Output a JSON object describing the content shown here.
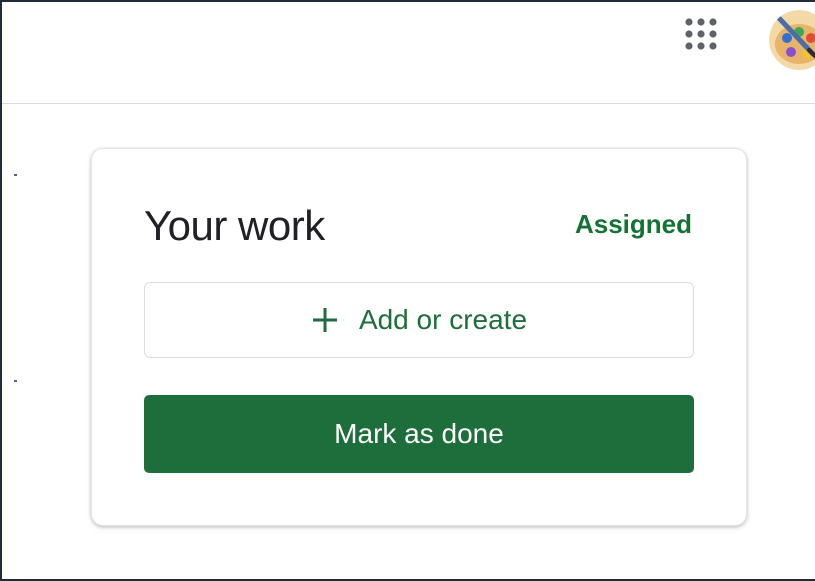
{
  "header": {
    "apps_icon": "apps-grid-icon",
    "avatar_icon": "palette-avatar"
  },
  "work_card": {
    "title": "Your work",
    "status": "Assigned",
    "add_button_label": "Add or create",
    "add_icon": "plus-icon",
    "done_button_label": "Mark as done"
  },
  "colors": {
    "accent_green": "#1e6e3b",
    "status_green": "#137333",
    "title_text": "#202124",
    "border": "#dadce0",
    "frame": "#1f2a3a"
  }
}
